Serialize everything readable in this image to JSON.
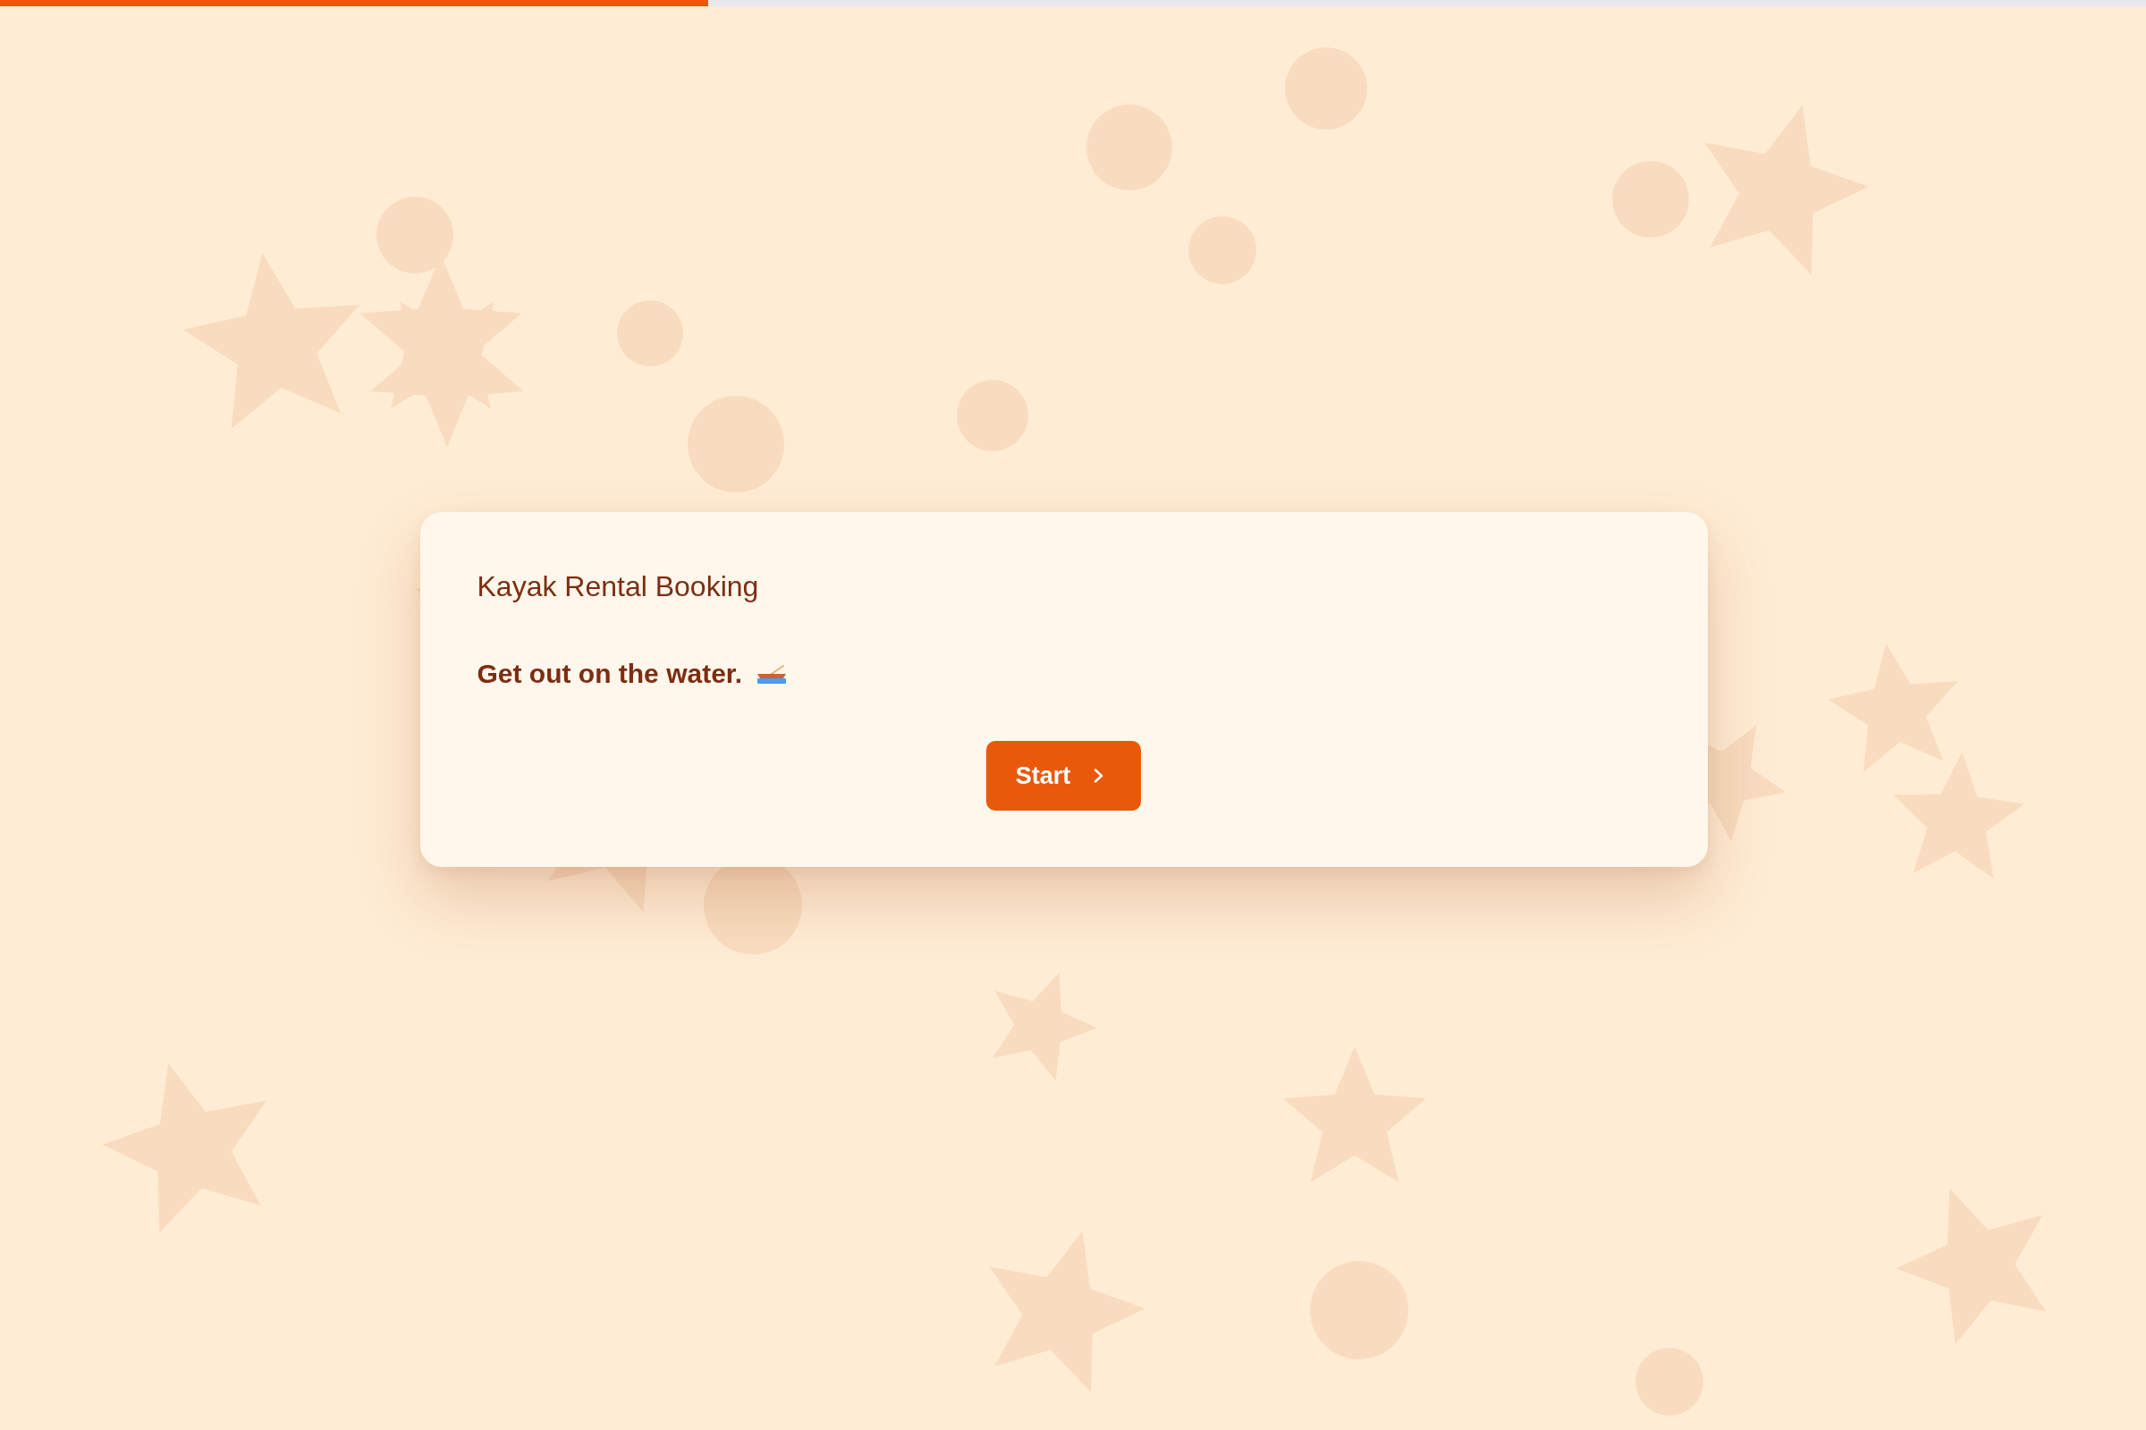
{
  "progress": {
    "level": 0.33
  },
  "card": {
    "title": "Kayak Rental Booking",
    "subtitle": "Get out on the water."
  },
  "buttons": [
    {
      "label": "Start"
    }
  ]
}
